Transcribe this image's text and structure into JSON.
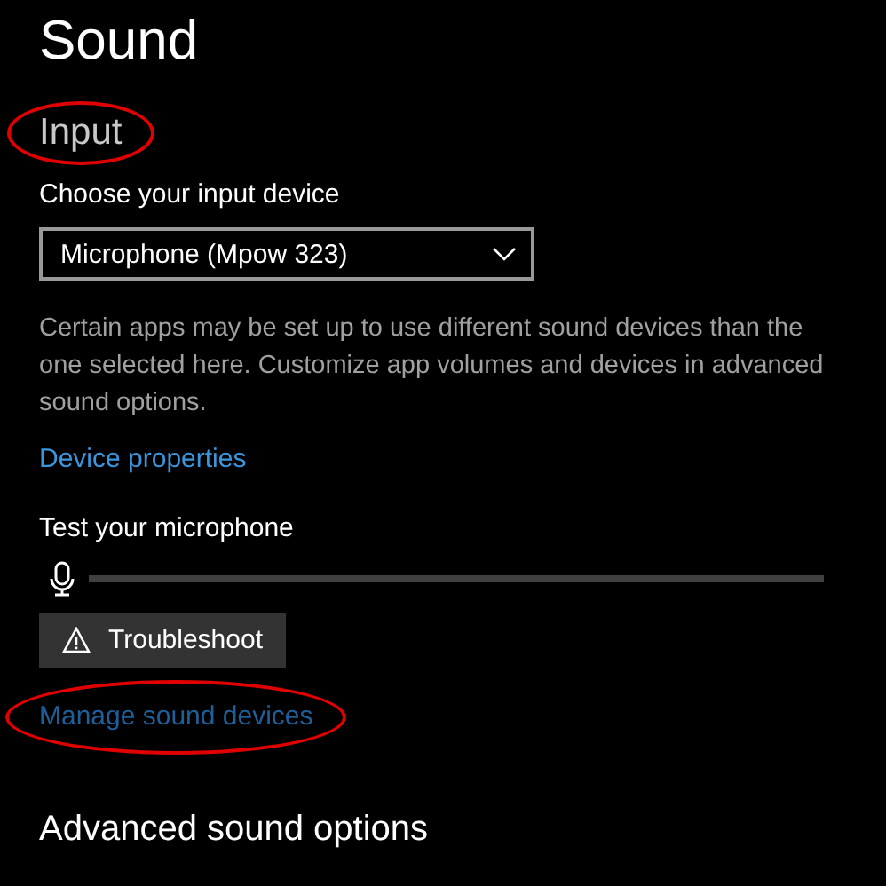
{
  "title": "Sound",
  "input_heading": {
    "text": "Input",
    "highlighted": true
  },
  "device_label": "Choose your input device",
  "device_dropdown": {
    "value": "Microphone (Mpow 323)"
  },
  "description": "Certain apps may be set up to use different sound devices than the one selected here. Customize app volumes and devices in advanced sound options.",
  "device_properties_link": {
    "text": "Device properties"
  },
  "test_label": "Test your microphone",
  "mic_meter": {
    "level": 0
  },
  "troubleshoot_button": "Troubleshoot",
  "manage_link": {
    "text": "Manage sound devices",
    "highlighted": true
  },
  "advanced_heading": "Advanced sound options"
}
